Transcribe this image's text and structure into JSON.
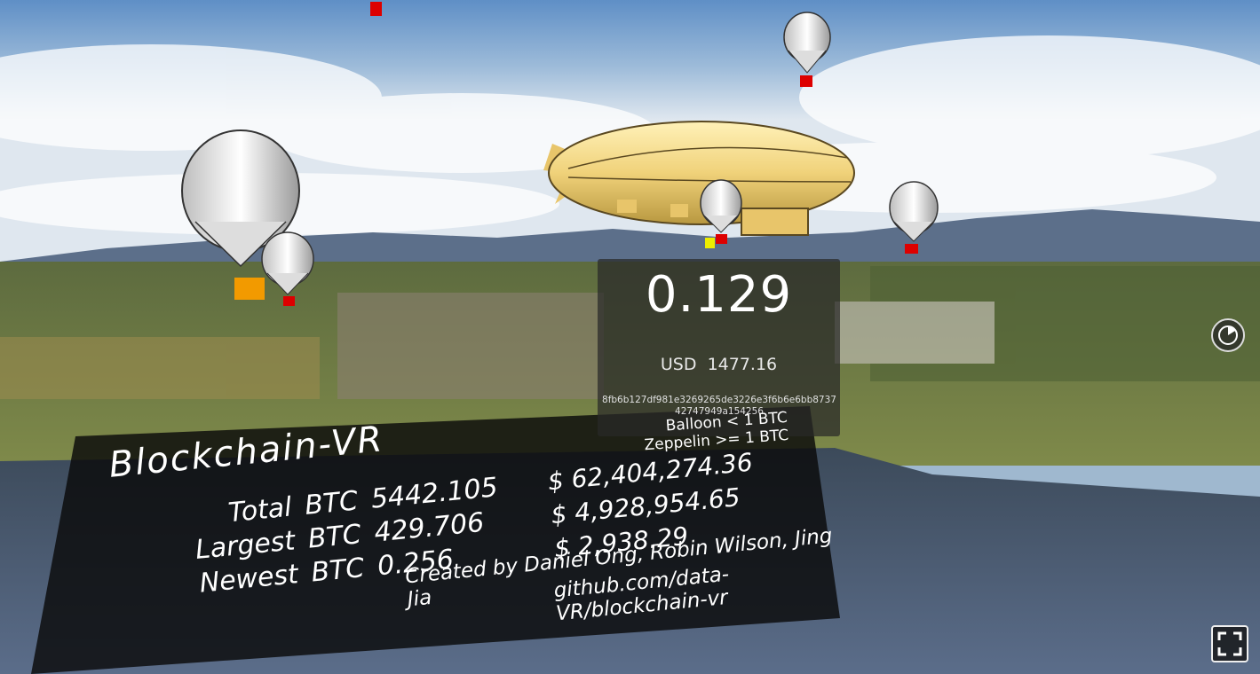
{
  "transaction": {
    "btc_amount": "0.129",
    "usd_label": "USD",
    "usd_amount": "1477.16",
    "hash": "8fb6b127df981e3269265de3226e3f6b6e6bb8737 4274794​9a154256"
  },
  "legend": {
    "balloon": "Balloon < 1 BTC",
    "zeppelin": "Zeppelin >= 1 BTC"
  },
  "board": {
    "title": "Blockchain-VR",
    "rows": [
      {
        "label": "Total",
        "unit": "BTC",
        "btc": "5442.105",
        "usd": "$  62,404,274.36"
      },
      {
        "label": "Largest",
        "unit": "BTC",
        "btc": "429.706",
        "usd": "$  4,928,954.65"
      },
      {
        "label": "Newest",
        "unit": "BTC",
        "btc": "0.256",
        "usd": "$  2,938.29"
      }
    ],
    "credits": "Created  by  Daniel  Ong,  Robin  Wilson,  Jing  Jia",
    "repo": "github.com/data-VR/blockchain-vr"
  },
  "controls": {
    "compass_icon": "compass-icon",
    "fullscreen_icon": "fullscreen-icon"
  },
  "colors": {
    "balloon_basket": "#e00000",
    "zeppelin": "#f2d88a",
    "panel_bg": "#282828"
  }
}
